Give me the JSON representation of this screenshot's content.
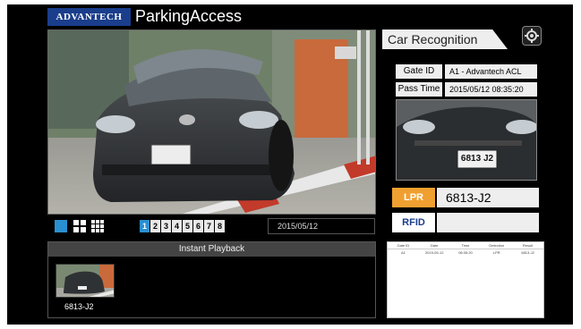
{
  "app": {
    "brand": "ADVANTECH",
    "title": "ParkingAccess"
  },
  "camera": {
    "view_name": "live-camera"
  },
  "layout": {
    "channels": [
      "1",
      "2",
      "3",
      "4",
      "5",
      "6",
      "7",
      "8"
    ],
    "active_channel": "1",
    "date": "2015/05/12"
  },
  "playback": {
    "header": "Instant Playback",
    "items": [
      {
        "plate": "6813-J2"
      }
    ]
  },
  "recognition": {
    "tab": "Car Recognition",
    "gate_label": "Gate ID",
    "gate_value": "A1 - Advantech ACL",
    "time_label": "Pass Time",
    "time_value": "2015/05/12 08:35:20",
    "crop_plate": "6813 J2",
    "lpr_label": "LPR",
    "lpr_value": "6813-J2",
    "rfid_label": "RFID",
    "rfid_value": ""
  },
  "log": {
    "columns": [
      "Gate ID",
      "Date",
      "Time",
      "Detection",
      "Result"
    ],
    "rows": [
      [
        "A1",
        "2015-05-12",
        "08:35:20",
        "LPR",
        "6813-J2"
      ]
    ]
  },
  "colors": {
    "lpr_badge": "#f0a030",
    "rfid_badge": "#ffffff",
    "active_channel": "#2a8fd0",
    "brand": "#1a3e8c"
  }
}
